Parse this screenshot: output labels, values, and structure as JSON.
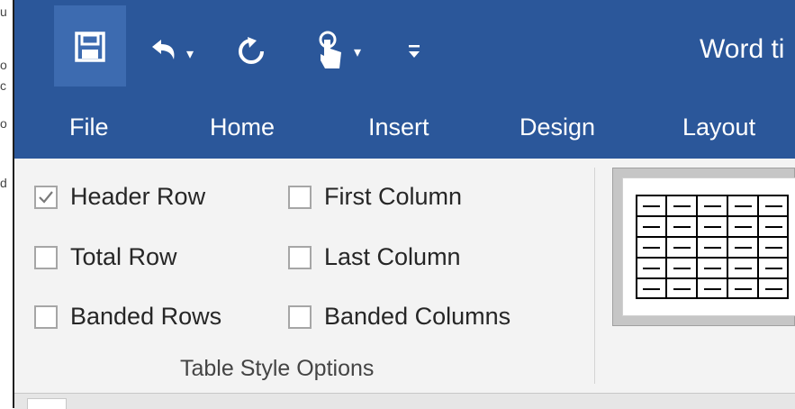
{
  "window": {
    "title": "Word ti"
  },
  "quick_access": {
    "save_icon": "save-icon",
    "undo_icon": "undo-icon",
    "redo_icon": "redo-icon",
    "touch_mode_icon": "touch-mode-icon",
    "customize_icon": "customize-qat-icon"
  },
  "tabs": [
    {
      "label": "File"
    },
    {
      "label": "Home"
    },
    {
      "label": "Insert"
    },
    {
      "label": "Design"
    },
    {
      "label": "Layout"
    }
  ],
  "table_style_options": {
    "group_label": "Table Style Options",
    "options": [
      {
        "label": "Header Row",
        "checked": true
      },
      {
        "label": "Total Row",
        "checked": false
      },
      {
        "label": "Banded Rows",
        "checked": false
      },
      {
        "label": "First Column",
        "checked": false
      },
      {
        "label": "Last Column",
        "checked": false
      },
      {
        "label": "Banded Columns",
        "checked": false
      }
    ]
  },
  "colors": {
    "titlebar": "#2b579a",
    "ribbon": "#f3f3f3",
    "checkbox_border": "#a6a6a6"
  }
}
